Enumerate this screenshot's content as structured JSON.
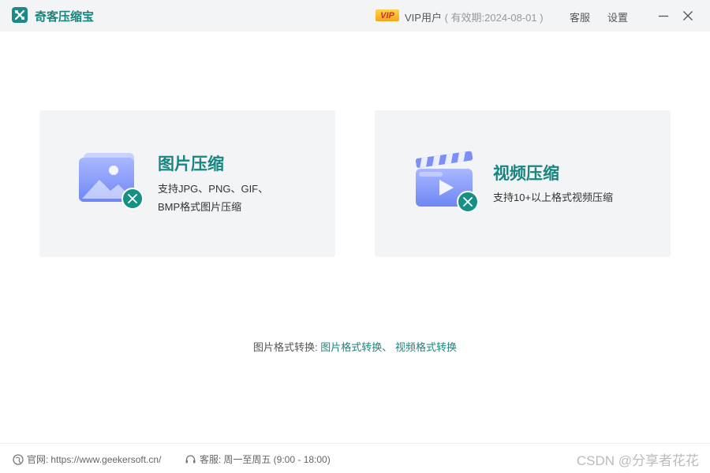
{
  "app": {
    "title": "奇客压缩宝"
  },
  "account": {
    "vip_badge": "VIP",
    "user_label": "VIP用户",
    "expiry": "( 有效期:2024-08-01 )"
  },
  "topbar": {
    "service": "客服",
    "settings": "设置"
  },
  "cards": {
    "image": {
      "title": "图片压缩",
      "desc_line1": "支持JPG、PNG、GIF、",
      "desc_line2": "BMP格式图片压缩"
    },
    "video": {
      "title": "视频压缩",
      "desc_line1": "支持10+以上格式视频压缩"
    }
  },
  "conversion": {
    "label": "图片格式转换:",
    "image_link": "图片格式转换",
    "separator": "、",
    "video_link": "视频格式转换"
  },
  "footer": {
    "website_label": "官网:",
    "website_url": "https://www.geekersoft.cn/",
    "service_label": "客服:",
    "service_hours": "周一至周五 (9:00 - 18:00)",
    "watermark": "CSDN @分享者花花"
  },
  "colors": {
    "brand": "#18857f",
    "accent_icon": "#1c8a86",
    "card_bg": "#f3f4f6"
  },
  "icons": [
    "app-logo-icon",
    "minimize-icon",
    "close-icon",
    "image-icon",
    "video-clapper-icon",
    "compress-badge-icon",
    "globe-icon",
    "headset-icon"
  ]
}
